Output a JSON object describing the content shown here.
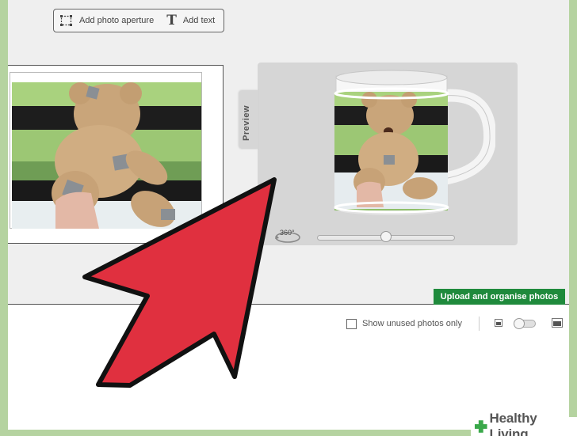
{
  "toolbar": {
    "add_aperture_label": "Add photo aperture",
    "add_text_label": "Add text",
    "add_text_glyph": "T"
  },
  "preview": {
    "tab_label": "Preview",
    "rotate_label": "360°",
    "rotation_slider_value": 0.5
  },
  "actions": {
    "upload_label": "Upload and organise photos"
  },
  "filters": {
    "show_unused_label": "Show unused photos only",
    "show_unused_checked": false
  },
  "watermark": {
    "text": "Healthy Living"
  },
  "icons": {
    "aperture": "photo-aperture-icon",
    "text": "text-icon",
    "rotate": "rotate-360-icon",
    "small_view": "small-photo-icon",
    "large_view": "large-photo-icon"
  },
  "colors": {
    "upload_button": "#1f8a3c",
    "arrow": "#e0303f",
    "frame": "#b5d3a0"
  }
}
